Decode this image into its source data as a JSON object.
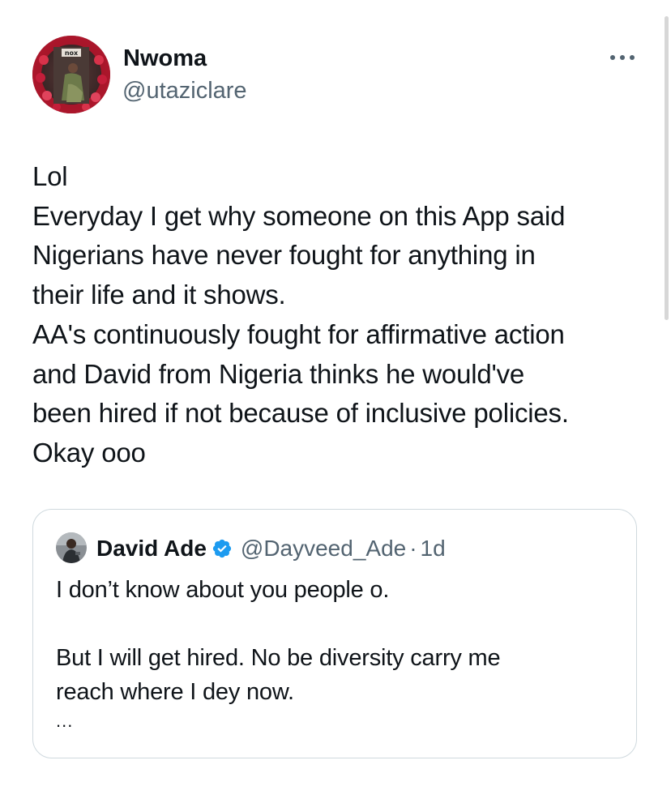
{
  "tweet": {
    "author": {
      "name": "Nwoma",
      "handle": "@utaziclare",
      "avatar_badge_text": "nox"
    },
    "more_icon": "more-horizontal-icon",
    "lines": [
      "Lol",
      "Everyday I get why someone on this App said",
      "Nigerians have never fought for anything in",
      "their life and it shows.",
      "AA's continuously fought for affirmative action",
      "and David from Nigeria thinks he would've",
      "been hired if not because of inclusive policies.",
      "Okay ooo"
    ]
  },
  "quote": {
    "author": {
      "name": "David Ade",
      "handle": "@Dayveed_Ade",
      "separator": "·",
      "time": "1d",
      "verified_icon": "verified-badge-icon"
    },
    "lines_first": [
      "I don’t know about you people o."
    ],
    "lines_second": [
      "But I will get hired. No be diversity carry me",
      "reach where I dey now."
    ],
    "ellipsis": "..."
  },
  "colors": {
    "text_primary": "#0f1419",
    "text_secondary": "#536471",
    "border": "#cfd9de",
    "verified": "#1d9bf0"
  }
}
